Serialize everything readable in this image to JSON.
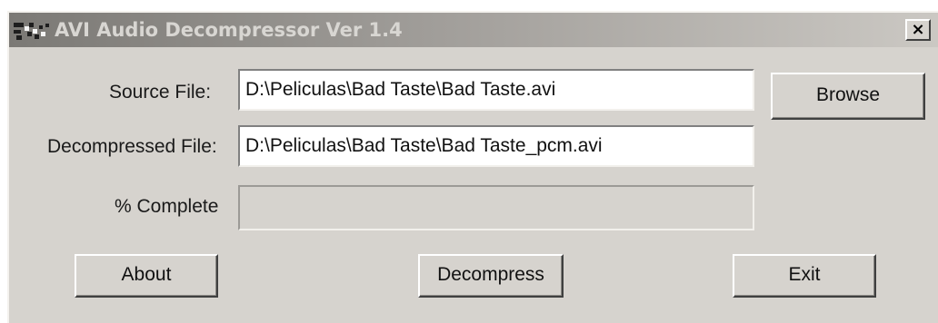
{
  "window": {
    "title": "AVI Audio Decompressor Ver 1.4",
    "close_label": "×"
  },
  "form": {
    "source_label": "Source File:",
    "source_value": "D:\\Peliculas\\Bad Taste\\Bad Taste.avi",
    "decompressed_label": "Decompressed File:",
    "decompressed_value": "D:\\Peliculas\\Bad Taste\\Bad Taste_pcm.avi",
    "progress_label": "% Complete",
    "progress_fraction": 0
  },
  "buttons": {
    "browse": "Browse",
    "about": "About",
    "decompress": "Decompress",
    "exit": "Exit"
  },
  "icons": {
    "app": "app-icon",
    "close": "close-icon"
  }
}
